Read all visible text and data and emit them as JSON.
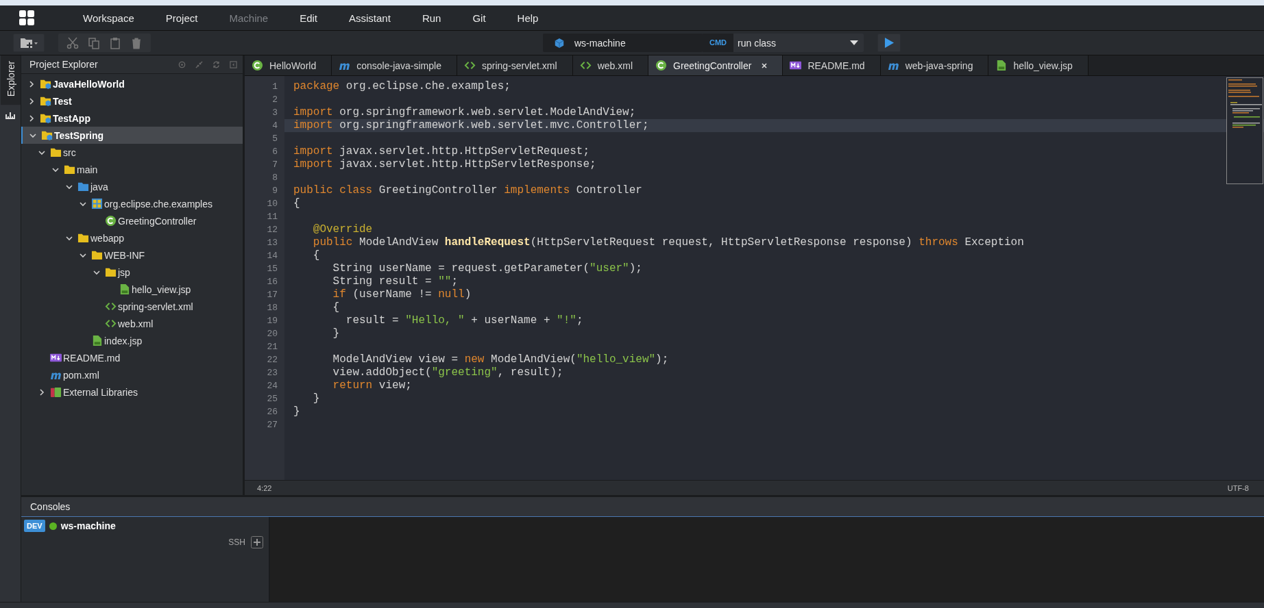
{
  "menu": [
    {
      "label": "Workspace",
      "disabled": false
    },
    {
      "label": "Project",
      "disabled": false
    },
    {
      "label": "Machine",
      "disabled": true
    },
    {
      "label": "Edit",
      "disabled": false
    },
    {
      "label": "Assistant",
      "disabled": false
    },
    {
      "label": "Run",
      "disabled": false
    },
    {
      "label": "Git",
      "disabled": false
    },
    {
      "label": "Help",
      "disabled": false
    }
  ],
  "toolbar": {
    "machine": "ws-machine",
    "command_badge": "CMD",
    "command": "run class"
  },
  "side_tab": "Explorer",
  "explorer": {
    "title": "Project Explorer",
    "tree": [
      {
        "label": "JavaHelloWorld",
        "kind": "project",
        "expanded": false,
        "selected": false
      },
      {
        "label": "Test",
        "kind": "project",
        "expanded": false,
        "selected": false
      },
      {
        "label": "TestApp",
        "kind": "project",
        "expanded": false,
        "selected": false
      },
      {
        "label": "TestSpring",
        "kind": "project",
        "expanded": true,
        "selected": true,
        "children": [
          {
            "label": "src",
            "kind": "folder",
            "expanded": true,
            "selected": false,
            "children": [
              {
                "label": "main",
                "kind": "folder",
                "expanded": true,
                "selected": false,
                "children": [
                  {
                    "label": "java",
                    "kind": "source-folder",
                    "expanded": true,
                    "selected": false,
                    "children": [
                      {
                        "label": "org.eclipse.che.examples",
                        "kind": "package",
                        "expanded": true,
                        "selected": false,
                        "children": [
                          {
                            "label": "GreetingController",
                            "kind": "class",
                            "selected": false
                          }
                        ]
                      }
                    ]
                  },
                  {
                    "label": "webapp",
                    "kind": "folder",
                    "expanded": true,
                    "selected": false,
                    "children": [
                      {
                        "label": "WEB-INF",
                        "kind": "folder",
                        "expanded": true,
                        "selected": false,
                        "children": [
                          {
                            "label": "jsp",
                            "kind": "folder",
                            "expanded": true,
                            "selected": false,
                            "children": [
                              {
                                "label": "hello_view.jsp",
                                "kind": "jsp",
                                "selected": false
                              }
                            ]
                          },
                          {
                            "label": "spring-servlet.xml",
                            "kind": "xml",
                            "selected": false
                          },
                          {
                            "label": "web.xml",
                            "kind": "xml",
                            "selected": false
                          }
                        ]
                      },
                      {
                        "label": "index.jsp",
                        "kind": "jsp",
                        "selected": false
                      }
                    ]
                  }
                ]
              }
            ]
          },
          {
            "label": "README.md",
            "kind": "markdown",
            "selected": false
          },
          {
            "label": "pom.xml",
            "kind": "maven",
            "selected": false
          },
          {
            "label": "External Libraries",
            "kind": "library",
            "expanded": false,
            "selected": false
          }
        ]
      }
    ]
  },
  "tabs": [
    {
      "label": "HelloWorld",
      "kind": "class",
      "selected": false
    },
    {
      "label": "console-java-simple",
      "kind": "maven",
      "selected": false
    },
    {
      "label": "spring-servlet.xml",
      "kind": "xml",
      "selected": false
    },
    {
      "label": "web.xml",
      "kind": "xml",
      "selected": false
    },
    {
      "label": "GreetingController",
      "kind": "class",
      "selected": true
    },
    {
      "label": "README.md",
      "kind": "markdown",
      "selected": false
    },
    {
      "label": "web-java-spring",
      "kind": "maven",
      "selected": false
    },
    {
      "label": "hello_view.jsp",
      "kind": "jsp",
      "selected": false
    }
  ],
  "code": {
    "lines": [
      {
        "number": "1",
        "current": false,
        "tokens": [
          {
            "kind": "keyword",
            "text": "package"
          },
          {
            "kind": "plain",
            "text": " org.eclipse.che.examples;"
          }
        ]
      },
      {
        "number": "2",
        "current": false
      },
      {
        "number": "3",
        "current": false,
        "tokens": [
          {
            "kind": "keyword",
            "text": "import"
          },
          {
            "kind": "plain",
            "text": " org.springframework.web.servlet.ModelAndView;"
          }
        ]
      },
      {
        "number": "4",
        "current": true,
        "tokens": [
          {
            "kind": "keyword",
            "text": "import"
          },
          {
            "kind": "plain",
            "text": " org.springframework.web.servlet.mvc.Controller;"
          }
        ]
      },
      {
        "number": "5",
        "current": false
      },
      {
        "number": "6",
        "current": false,
        "tokens": [
          {
            "kind": "keyword",
            "text": "import"
          },
          {
            "kind": "plain",
            "text": " javax.servlet.http.HttpServletRequest;"
          }
        ]
      },
      {
        "number": "7",
        "current": false,
        "tokens": [
          {
            "kind": "keyword",
            "text": "import"
          },
          {
            "kind": "plain",
            "text": " javax.servlet.http.HttpServletResponse;"
          }
        ]
      },
      {
        "number": "8",
        "current": false
      },
      {
        "number": "9",
        "current": false,
        "tokens": [
          {
            "kind": "keyword",
            "text": "public class"
          },
          {
            "kind": "plain",
            "text": " GreetingController "
          },
          {
            "kind": "keyword",
            "text": "implements"
          },
          {
            "kind": "plain",
            "text": " Controller"
          }
        ]
      },
      {
        "number": "10",
        "current": false,
        "tokens": [
          {
            "kind": "plain",
            "text": "{"
          }
        ]
      },
      {
        "number": "11",
        "current": false
      },
      {
        "number": "12",
        "current": false,
        "tokens": [
          {
            "kind": "annotation",
            "text": "   @Override"
          }
        ]
      },
      {
        "number": "13",
        "current": false,
        "tokens": [
          {
            "kind": "keyword",
            "text": "   public"
          },
          {
            "kind": "plain",
            "text": " ModelAndView "
          },
          {
            "kind": "method",
            "text": "handleRequest"
          },
          {
            "kind": "plain",
            "text": "(HttpServletRequest request, HttpServletResponse response) "
          },
          {
            "kind": "keyword",
            "text": "throws"
          },
          {
            "kind": "plain",
            "text": " Exception"
          }
        ]
      },
      {
        "number": "14",
        "current": false,
        "tokens": [
          {
            "kind": "plain",
            "text": "   {"
          }
        ]
      },
      {
        "number": "15",
        "current": false,
        "tokens": [
          {
            "kind": "plain",
            "text": "      String userName = request.getParameter("
          },
          {
            "kind": "string",
            "text": "\"user\""
          },
          {
            "kind": "plain",
            "text": ");"
          }
        ]
      },
      {
        "number": "16",
        "current": false,
        "tokens": [
          {
            "kind": "plain",
            "text": "      String result = "
          },
          {
            "kind": "string",
            "text": "\"\""
          },
          {
            "kind": "plain",
            "text": ";"
          }
        ]
      },
      {
        "number": "17",
        "current": false,
        "tokens": [
          {
            "kind": "keyword",
            "text": "      if"
          },
          {
            "kind": "plain",
            "text": " (userName != "
          },
          {
            "kind": "keyword",
            "text": "null"
          },
          {
            "kind": "plain",
            "text": ")"
          }
        ]
      },
      {
        "number": "18",
        "current": false,
        "tokens": [
          {
            "kind": "plain",
            "text": "      {"
          }
        ]
      },
      {
        "number": "19",
        "current": false,
        "tokens": [
          {
            "kind": "plain",
            "text": "        result = "
          },
          {
            "kind": "string",
            "text": "\"Hello, \""
          },
          {
            "kind": "plain",
            "text": " + userName + "
          },
          {
            "kind": "string",
            "text": "\"!\""
          },
          {
            "kind": "plain",
            "text": ";"
          }
        ]
      },
      {
        "number": "20",
        "current": false,
        "tokens": [
          {
            "kind": "plain",
            "text": "      }"
          }
        ]
      },
      {
        "number": "21",
        "current": false
      },
      {
        "number": "22",
        "current": false,
        "tokens": [
          {
            "kind": "plain",
            "text": "      ModelAndView view = "
          },
          {
            "kind": "keyword",
            "text": "new"
          },
          {
            "kind": "plain",
            "text": " ModelAndView("
          },
          {
            "kind": "string",
            "text": "\"hello_view\""
          },
          {
            "kind": "plain",
            "text": ");"
          }
        ]
      },
      {
        "number": "23",
        "current": false,
        "tokens": [
          {
            "kind": "plain",
            "text": "      view.addObject("
          },
          {
            "kind": "string",
            "text": "\"greeting\""
          },
          {
            "kind": "plain",
            "text": ", result);"
          }
        ]
      },
      {
        "number": "24",
        "current": false,
        "tokens": [
          {
            "kind": "keyword",
            "text": "      return"
          },
          {
            "kind": "plain",
            "text": " view;"
          }
        ]
      },
      {
        "number": "25",
        "current": false,
        "tokens": [
          {
            "kind": "plain",
            "text": "   }"
          }
        ]
      },
      {
        "number": "26",
        "current": false,
        "tokens": [
          {
            "kind": "plain",
            "text": "}"
          }
        ]
      },
      {
        "number": "27",
        "current": false
      }
    ]
  },
  "status_bar": {
    "position": "4:22",
    "encoding": "UTF-8"
  },
  "consoles": {
    "title": "Consoles",
    "machines": [
      {
        "badge": "DEV",
        "name": "ws-machine",
        "color": "#5bb323",
        "terminal": "SSH"
      }
    ]
  }
}
